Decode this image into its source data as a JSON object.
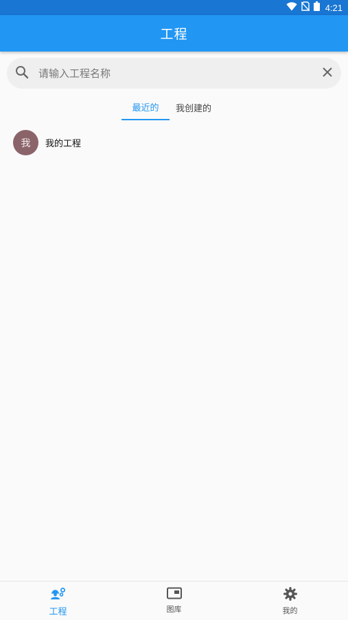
{
  "status_bar": {
    "time": "4:21",
    "icons": [
      "wifi-icon",
      "no-sim-icon",
      "battery-icon"
    ]
  },
  "app_bar": {
    "title": "工程"
  },
  "search": {
    "placeholder": "请输入工程名称",
    "icons": [
      "search-icon",
      "clear-icon"
    ]
  },
  "tabs": [
    {
      "label": "最近的",
      "active": true
    },
    {
      "label": "我创建的",
      "active": false
    }
  ],
  "projects": [
    {
      "avatar_text": "我",
      "name": "我的工程"
    }
  ],
  "bottom_nav": [
    {
      "label": "工程",
      "icon": "engineer-icon",
      "active": true
    },
    {
      "label": "图库",
      "icon": "gallery-icon",
      "active": false
    },
    {
      "label": "我的",
      "icon": "settings-icon",
      "active": false
    }
  ],
  "colors": {
    "primary": "#2196f3",
    "status_bar": "#1976d2",
    "avatar": "#8b646a"
  }
}
